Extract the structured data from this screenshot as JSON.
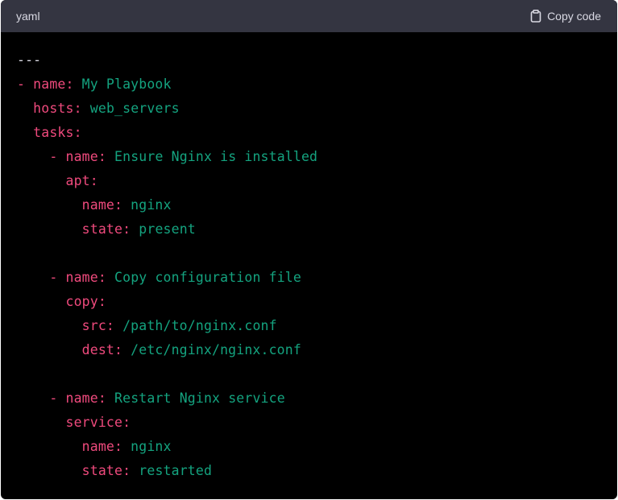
{
  "header": {
    "language": "yaml",
    "copy_label": "Copy code",
    "copy_icon": "clipboard-icon"
  },
  "colors": {
    "key": "#ef4a7d",
    "value": "#14a37f",
    "plain": "#d9d9e3",
    "header_bg": "#343541",
    "code_bg": "#000000"
  },
  "code": {
    "lines": [
      {
        "indent": "",
        "plain": "---"
      },
      {
        "indent": "",
        "key": "- name:",
        "value": " My Playbook"
      },
      {
        "indent": "  ",
        "key": "hosts:",
        "value": " web_servers"
      },
      {
        "indent": "  ",
        "key": "tasks:"
      },
      {
        "indent": "    ",
        "key": "- name:",
        "value": " Ensure Nginx is installed"
      },
      {
        "indent": "      ",
        "key": "apt:"
      },
      {
        "indent": "        ",
        "key": "name:",
        "value": " nginx"
      },
      {
        "indent": "        ",
        "key": "state:",
        "value": " present"
      },
      {
        "indent": "",
        "blank": true
      },
      {
        "indent": "    ",
        "key": "- name:",
        "value": " Copy configuration file"
      },
      {
        "indent": "      ",
        "key": "copy:"
      },
      {
        "indent": "        ",
        "key": "src:",
        "value": " /path/to/nginx.conf"
      },
      {
        "indent": "        ",
        "key": "dest:",
        "value": " /etc/nginx/nginx.conf"
      },
      {
        "indent": "",
        "blank": true
      },
      {
        "indent": "    ",
        "key": "- name:",
        "value": " Restart Nginx service"
      },
      {
        "indent": "      ",
        "key": "service:"
      },
      {
        "indent": "        ",
        "key": "name:",
        "value": " nginx"
      },
      {
        "indent": "        ",
        "key": "state:",
        "value": " restarted"
      }
    ]
  }
}
